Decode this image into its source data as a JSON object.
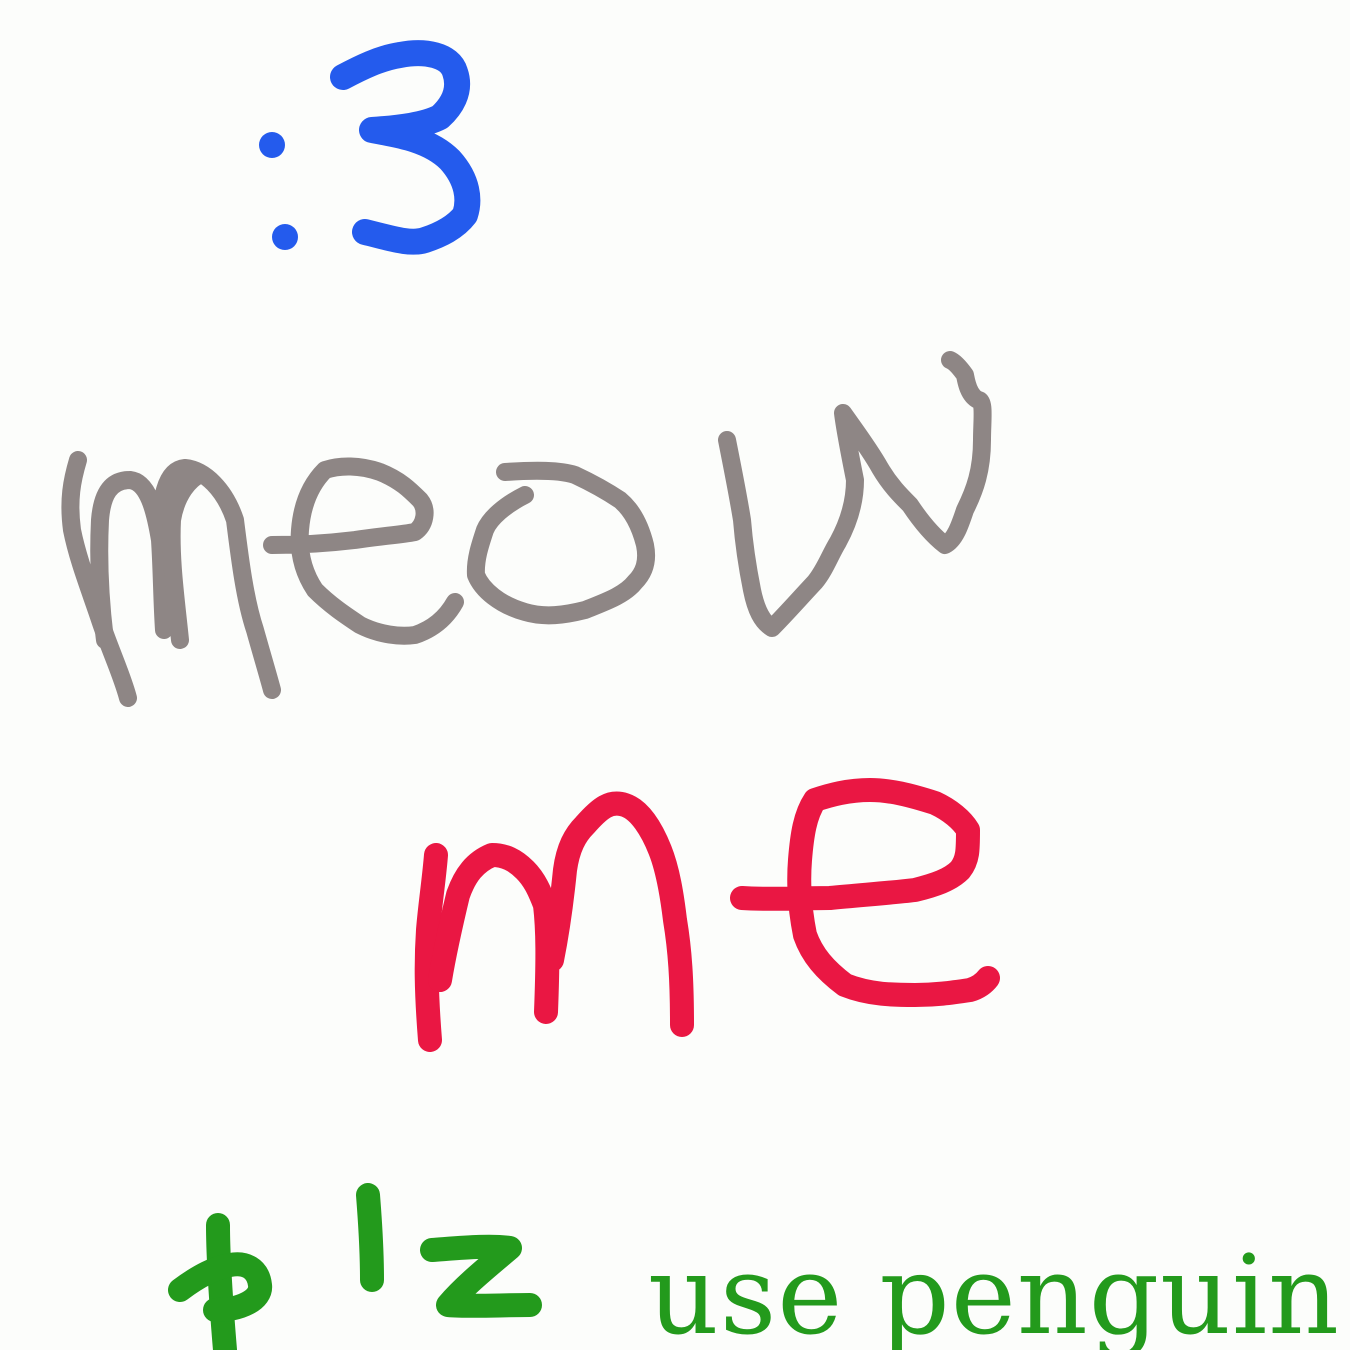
{
  "canvas": {
    "background": "#fcfdfb"
  },
  "drawings": {
    "face": {
      "text": ":3",
      "color": "#245bed"
    },
    "meow": {
      "text": "meow",
      "color": "#8e8685"
    },
    "me": {
      "text": "me",
      "color": "#ea1743"
    },
    "plz": {
      "text": "p'z",
      "color": "#239a1c"
    }
  },
  "typed_text": {
    "text": "use penguin",
    "color": "#239a1c"
  }
}
